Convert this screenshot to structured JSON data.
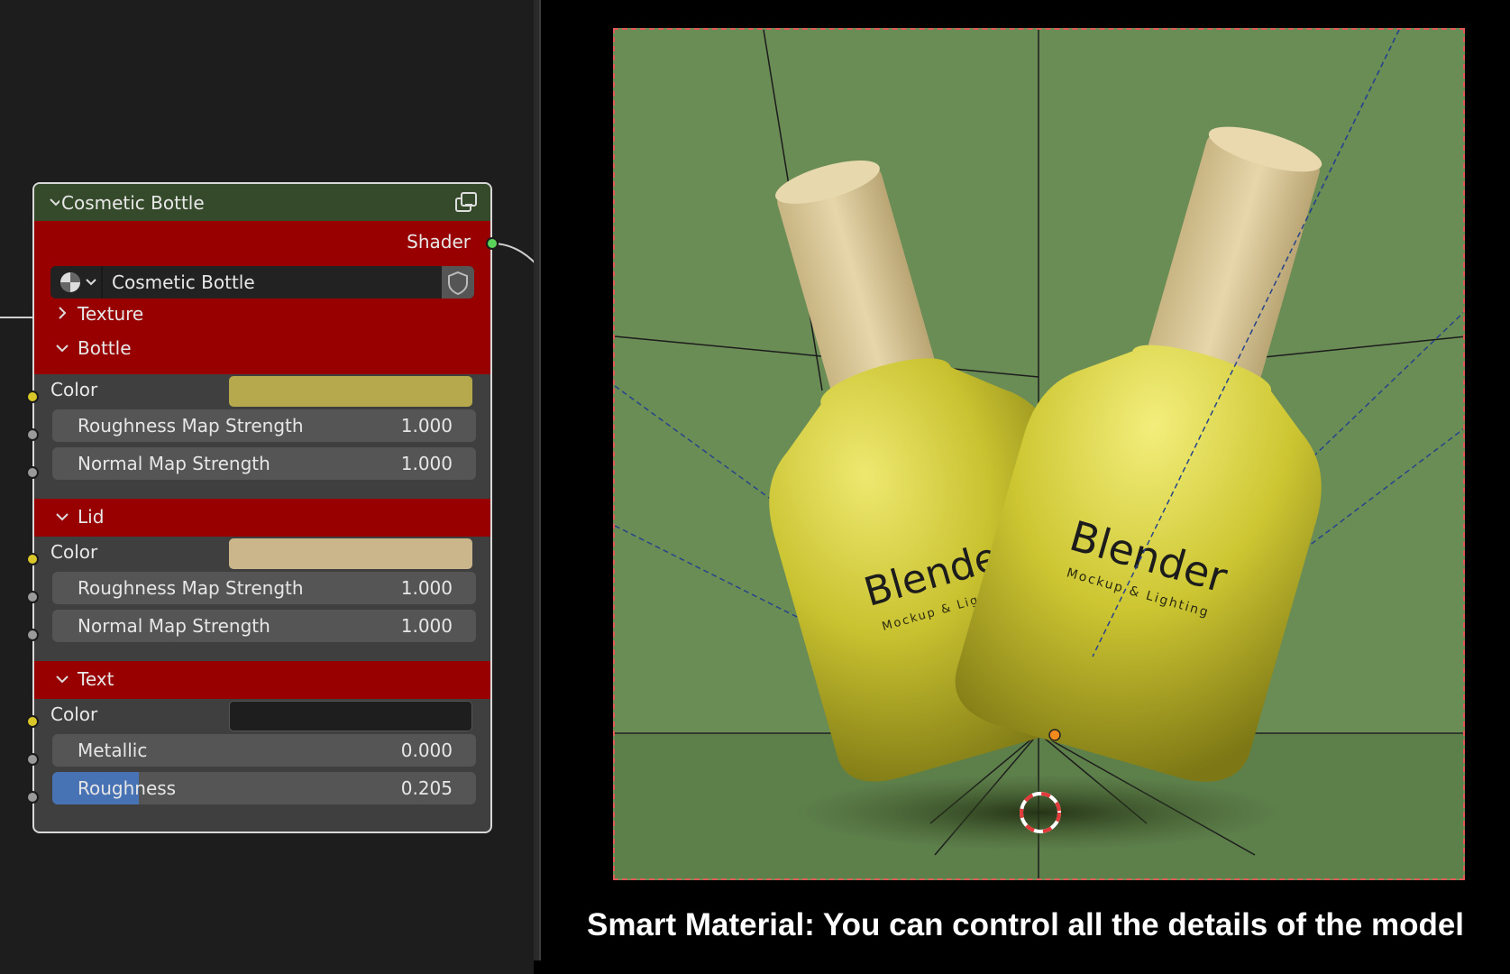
{
  "node": {
    "title": "Cosmetic Bottle",
    "output_label": "Shader",
    "material_name": "Cosmetic Bottle",
    "panels": {
      "texture": "Texture",
      "bottle": "Bottle",
      "lid": "Lid",
      "text": "Text"
    },
    "bottle": {
      "color_label": "Color",
      "color_value": "#b5a84d",
      "roughness_map_label": "Roughness Map Strength",
      "roughness_map_value": "1.000",
      "normal_map_label": "Normal Map Strength",
      "normal_map_value": "1.000"
    },
    "lid": {
      "color_label": "Color",
      "color_value": "#cbb58a",
      "roughness_map_label": "Roughness Map Strength",
      "roughness_map_value": "1.000",
      "normal_map_label": "Normal Map Strength",
      "normal_map_value": "1.000"
    },
    "text": {
      "color_label": "Color",
      "color_value": "#1e1e1e",
      "metallic_label": "Metallic",
      "metallic_value": "0.000",
      "roughness_label": "Roughness",
      "roughness_value": "0.205",
      "roughness_fraction": 0.205
    }
  },
  "viewport": {
    "bottle_front_brand": "Blender",
    "bottle_front_tagline": "Mockup & Lighting",
    "bottle_back_brand": "Blender",
    "bottle_back_tagline": "Mockup & Lighting"
  },
  "caption": "Smart Material: You can control all the details of the model",
  "colors": {
    "node_header": "#344a2a",
    "panel_red": "#980000",
    "background_green": "#6a8c55",
    "bottle_yellow": "#c9c230",
    "cork": "#d8c79a"
  }
}
